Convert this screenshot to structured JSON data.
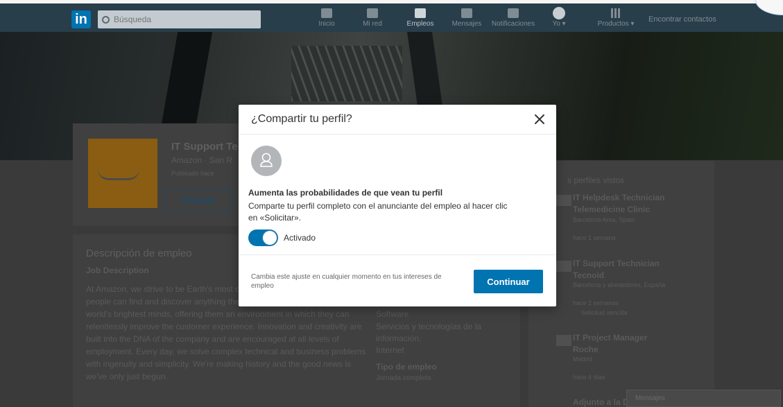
{
  "nav": {
    "logo": "in",
    "search_placeholder": "Búsqueda",
    "items": [
      {
        "label": "Inicio",
        "icon": "home-icon"
      },
      {
        "label": "Mi red",
        "icon": "network-icon"
      },
      {
        "label": "Empleos",
        "icon": "briefcase-icon",
        "active": true
      },
      {
        "label": "Mensajes",
        "icon": "messages-icon"
      },
      {
        "label": "Notificaciones",
        "icon": "bell-icon"
      },
      {
        "label": "Yo ▾",
        "icon": "avatar-icon"
      },
      {
        "label": "Productos ▾",
        "icon": "grid-icon"
      }
    ],
    "find_contacts": "Encontrar contactos"
  },
  "job": {
    "title": "IT Support Te",
    "company_location": "Amazon · San R",
    "posted": "Publicado hace",
    "save_label": "Guardar"
  },
  "description": {
    "heading": "Descripción de empleo",
    "subheading": "Job Description",
    "lines": [
      "At Amazon, we strive to be Earth's most cu",
      "people can find and discover anything the",
      "world's brightest minds, offering them an environment in which they can",
      "relentlessly improve the customer experience. Innovation and creativity are",
      "built into the DNA of the company and are encouraged at all levels of",
      "employment. Every day, we solve complex technical and business problems",
      "with ingenuity and simplicity. We're making history and the good news is",
      "we've only just begun."
    ]
  },
  "meta": {
    "lines": [
      "Software",
      "Servicios y tecnologías de la",
      "información,",
      "Internet"
    ],
    "type_heading": "Tipo de empleo",
    "type_value": "Jornada completa"
  },
  "sidebar": {
    "heading": "s perfiles vistos",
    "items": [
      {
        "title": "IT Helpdesk Technician",
        "company": "Telemedicine Clinic",
        "location": "Barcelona Area, Spain",
        "time": "hace 1 semana"
      },
      {
        "title": "IT Support Technician",
        "company": "Tecnoid",
        "location": "Barcelona y alrededores, España",
        "time": "hace 2 semanas",
        "badge": "Solicitud sencilla"
      },
      {
        "title": "IT Project Manager",
        "company": "Roche",
        "location": "Madrid",
        "time": "hace 4 días"
      },
      {
        "title": "Adjunto a la D"
      }
    ]
  },
  "messaging": {
    "label": "Mensajes"
  },
  "modal": {
    "title": "¿Compartir tu perfil?",
    "headline": "Aumenta las probabilidades de que vean tu perfil",
    "description": "Comparte tu perfil completo con el anunciante del empleo al hacer clic en «Solicitar».",
    "toggle_label": "Activado",
    "toggle_on": true,
    "footer_note": "Cambia este ajuste en cualquier momento en tus intereses de empleo",
    "continue_label": "Continuar",
    "accent_color": "#0073b1"
  }
}
